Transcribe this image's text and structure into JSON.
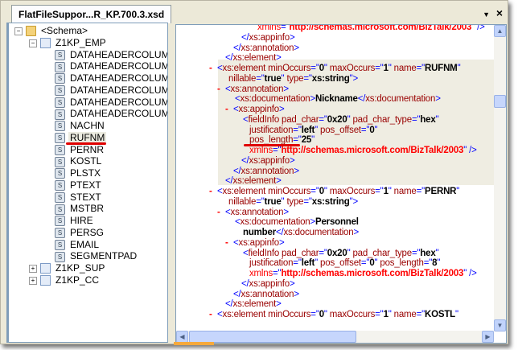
{
  "tab": {
    "title": "FlatFileSuppor...R_KP.700.3.xsd",
    "menu_icon": "dropdown-arrow-icon",
    "close_icon": "close-icon"
  },
  "tree": {
    "items": [
      {
        "label": "<Schema>",
        "level": 0,
        "icon": "folder-icon",
        "expander": "minus"
      },
      {
        "label": "Z1KP_EMP",
        "level": 1,
        "icon": "record-icon",
        "expander": "minus"
      },
      {
        "label": "DATAHEADERCOLUMN_S",
        "level": 2,
        "icon": "field-icon"
      },
      {
        "label": "DATAHEADERCOLUMN_N",
        "level": 2,
        "icon": "field-icon"
      },
      {
        "label": "DATAHEADERCOLUMN_D",
        "level": 2,
        "icon": "field-icon"
      },
      {
        "label": "DATAHEADERCOLUMN_S",
        "level": 2,
        "icon": "field-icon"
      },
      {
        "label": "DATAHEADERCOLUMN_F",
        "level": 2,
        "icon": "field-icon"
      },
      {
        "label": "DATAHEADERCOLUMN_H",
        "level": 2,
        "icon": "field-icon"
      },
      {
        "label": "NACHN",
        "level": 2,
        "icon": "field-icon"
      },
      {
        "label": "RUFNM",
        "level": 2,
        "icon": "field-icon",
        "selected": true
      },
      {
        "label": "PERNR",
        "level": 2,
        "icon": "field-icon"
      },
      {
        "label": "KOSTL",
        "level": 2,
        "icon": "field-icon"
      },
      {
        "label": "PLSTX",
        "level": 2,
        "icon": "field-icon"
      },
      {
        "label": "PTEXT",
        "level": 2,
        "icon": "field-icon"
      },
      {
        "label": "STEXT",
        "level": 2,
        "icon": "field-icon"
      },
      {
        "label": "MSTBR",
        "level": 2,
        "icon": "field-icon"
      },
      {
        "label": "HIRE",
        "level": 2,
        "icon": "field-icon"
      },
      {
        "label": "PERSG",
        "level": 2,
        "icon": "field-icon"
      },
      {
        "label": "EMAIL",
        "level": 2,
        "icon": "field-icon"
      },
      {
        "label": "SEGMENTPAD",
        "level": 2,
        "icon": "field-icon"
      },
      {
        "label": "Z1KP_SUP",
        "level": 1,
        "icon": "record-icon",
        "expander": "plus"
      },
      {
        "label": "Z1KP_CC",
        "level": 1,
        "icon": "record-icon",
        "expander": "plus"
      }
    ]
  },
  "annotation_color": "#e00000",
  "highlight_color": "#efede2",
  "xml": {
    "lines": [
      {
        "depth": 5,
        "segs": [
          [
            "x",
            "xmlns"
          ],
          [
            "t",
            "=\""
          ],
          [
            "u",
            "http://schemas.microsoft.com/BizTalk/2003"
          ],
          [
            "t",
            "\" />"
          ]
        ]
      },
      {
        "depth": 3,
        "segs": [
          [
            "t",
            "</"
          ],
          [
            "n",
            "xs:appinfo"
          ],
          [
            "t",
            ">"
          ]
        ]
      },
      {
        "depth": 2,
        "segs": [
          [
            "t",
            "</"
          ],
          [
            "n",
            "xs:annotation"
          ],
          [
            "t",
            ">"
          ]
        ]
      },
      {
        "depth": 1,
        "segs": [
          [
            "t",
            "</"
          ],
          [
            "n",
            "xs:element"
          ],
          [
            "t",
            ">"
          ]
        ]
      },
      {
        "depth": 0,
        "minus": true,
        "segs": [
          [
            "t",
            "<"
          ],
          [
            "n",
            "xs:element minOccurs"
          ],
          [
            "t",
            "=\""
          ],
          [
            "v",
            "0"
          ],
          [
            "t",
            "\" "
          ],
          [
            "n",
            "maxOccurs"
          ],
          [
            "t",
            "=\""
          ],
          [
            "v",
            "1"
          ],
          [
            "t",
            "\" "
          ],
          [
            "n",
            "name"
          ],
          [
            "t",
            "=\""
          ],
          [
            "v",
            "RUFNM"
          ],
          [
            "t",
            "\""
          ]
        ]
      },
      {
        "depth": 1.4,
        "segs": [
          [
            "n",
            "nillable"
          ],
          [
            "t",
            "=\""
          ],
          [
            "v",
            "true"
          ],
          [
            "t",
            "\" "
          ],
          [
            "n",
            "type"
          ],
          [
            "t",
            "=\""
          ],
          [
            "v",
            "xs:string"
          ],
          [
            "t",
            "\">"
          ]
        ]
      },
      {
        "depth": 1,
        "minus": true,
        "segs": [
          [
            "t",
            "<"
          ],
          [
            "n",
            "xs:annotation"
          ],
          [
            "t",
            ">"
          ]
        ]
      },
      {
        "depth": 2.2,
        "segs": [
          [
            "t",
            "<"
          ],
          [
            "n",
            "xs:documentation"
          ],
          [
            "t",
            ">"
          ],
          [
            "v",
            "Nickname"
          ],
          [
            "t",
            "</"
          ],
          [
            "n",
            "xs:documentation"
          ],
          [
            "t",
            ">"
          ]
        ]
      },
      {
        "depth": 2,
        "minus": true,
        "segs": [
          [
            "t",
            "<"
          ],
          [
            "n",
            "xs:appinfo"
          ],
          [
            "t",
            ">"
          ]
        ]
      },
      {
        "depth": 3.2,
        "segs": [
          [
            "t",
            "<"
          ],
          [
            "n",
            "fieldInfo pad_char"
          ],
          [
            "t",
            "=\""
          ],
          [
            "v",
            "0x20"
          ],
          [
            "t",
            "\" "
          ],
          [
            "n",
            "pad_char_type"
          ],
          [
            "t",
            "=\""
          ],
          [
            "v",
            "hex"
          ],
          [
            "t",
            "\""
          ]
        ]
      },
      {
        "depth": 4,
        "segs": [
          [
            "n",
            "justification"
          ],
          [
            "t",
            "=\""
          ],
          [
            "v",
            "left"
          ],
          [
            "t",
            "\" "
          ],
          [
            "n",
            "pos_offset"
          ],
          [
            "t",
            "=\""
          ],
          [
            "v",
            "0"
          ],
          [
            "t",
            "\""
          ]
        ]
      },
      {
        "depth": 4,
        "segs": [
          [
            "n",
            "pos_length"
          ],
          [
            "t",
            "=\""
          ],
          [
            "v",
            "25"
          ],
          [
            "t",
            "\""
          ]
        ]
      },
      {
        "depth": 4,
        "segs": [
          [
            "x",
            "xmlns"
          ],
          [
            "t",
            "=\""
          ],
          [
            "u",
            "http://schemas.microsoft.com/BizTalk/2003"
          ],
          [
            "t",
            "\" />"
          ]
        ]
      },
      {
        "depth": 3,
        "segs": [
          [
            "t",
            "</"
          ],
          [
            "n",
            "xs:appinfo"
          ],
          [
            "t",
            ">"
          ]
        ]
      },
      {
        "depth": 2,
        "segs": [
          [
            "t",
            "</"
          ],
          [
            "n",
            "xs:annotation"
          ],
          [
            "t",
            ">"
          ]
        ]
      },
      {
        "depth": 1,
        "segs": [
          [
            "t",
            "</"
          ],
          [
            "n",
            "xs:element"
          ],
          [
            "t",
            ">"
          ]
        ]
      },
      {
        "depth": 0,
        "minus": true,
        "segs": [
          [
            "t",
            "<"
          ],
          [
            "n",
            "xs:element minOccurs"
          ],
          [
            "t",
            "=\""
          ],
          [
            "v",
            "0"
          ],
          [
            "t",
            "\" "
          ],
          [
            "n",
            "maxOccurs"
          ],
          [
            "t",
            "=\""
          ],
          [
            "v",
            "1"
          ],
          [
            "t",
            "\" "
          ],
          [
            "n",
            "name"
          ],
          [
            "t",
            "=\""
          ],
          [
            "v",
            "PERNR"
          ],
          [
            "t",
            "\""
          ]
        ]
      },
      {
        "depth": 1.4,
        "segs": [
          [
            "n",
            "nillable"
          ],
          [
            "t",
            "=\""
          ],
          [
            "v",
            "true"
          ],
          [
            "t",
            "\" "
          ],
          [
            "n",
            "type"
          ],
          [
            "t",
            "=\""
          ],
          [
            "v",
            "xs:string"
          ],
          [
            "t",
            "\">"
          ]
        ]
      },
      {
        "depth": 1,
        "minus": true,
        "segs": [
          [
            "t",
            "<"
          ],
          [
            "n",
            "xs:annotation"
          ],
          [
            "t",
            ">"
          ]
        ]
      },
      {
        "depth": 2.2,
        "segs": [
          [
            "t",
            "<"
          ],
          [
            "n",
            "xs:documentation"
          ],
          [
            "t",
            ">"
          ],
          [
            "v",
            "Personnel"
          ]
        ]
      },
      {
        "depth": 3.2,
        "segs": [
          [
            "v",
            "number"
          ],
          [
            "t",
            "</"
          ],
          [
            "n",
            "xs:documentation"
          ],
          [
            "t",
            ">"
          ]
        ]
      },
      {
        "depth": 2,
        "minus": true,
        "segs": [
          [
            "t",
            "<"
          ],
          [
            "n",
            "xs:appinfo"
          ],
          [
            "t",
            ">"
          ]
        ]
      },
      {
        "depth": 3.2,
        "segs": [
          [
            "t",
            "<"
          ],
          [
            "n",
            "fieldInfo pad_char"
          ],
          [
            "t",
            "=\""
          ],
          [
            "v",
            "0x20"
          ],
          [
            "t",
            "\" "
          ],
          [
            "n",
            "pad_char_type"
          ],
          [
            "t",
            "=\""
          ],
          [
            "v",
            "hex"
          ],
          [
            "t",
            "\""
          ]
        ]
      },
      {
        "depth": 4,
        "segs": [
          [
            "n",
            "justification"
          ],
          [
            "t",
            "=\""
          ],
          [
            "v",
            "left"
          ],
          [
            "t",
            "\" "
          ],
          [
            "n",
            "pos_offset"
          ],
          [
            "t",
            "=\""
          ],
          [
            "v",
            "0"
          ],
          [
            "t",
            "\" "
          ],
          [
            "n",
            "pos_length"
          ],
          [
            "t",
            "=\""
          ],
          [
            "v",
            "8"
          ],
          [
            "t",
            "\""
          ]
        ]
      },
      {
        "depth": 4,
        "segs": [
          [
            "x",
            "xmlns"
          ],
          [
            "t",
            "=\""
          ],
          [
            "u",
            "http://schemas.microsoft.com/BizTalk/2003"
          ],
          [
            "t",
            "\" />"
          ]
        ]
      },
      {
        "depth": 3,
        "segs": [
          [
            "t",
            "</"
          ],
          [
            "n",
            "xs:appinfo"
          ],
          [
            "t",
            ">"
          ]
        ]
      },
      {
        "depth": 2,
        "segs": [
          [
            "t",
            "</"
          ],
          [
            "n",
            "xs:annotation"
          ],
          [
            "t",
            ">"
          ]
        ]
      },
      {
        "depth": 1,
        "segs": [
          [
            "t",
            "</"
          ],
          [
            "n",
            "xs:element"
          ],
          [
            "t",
            ">"
          ]
        ]
      },
      {
        "depth": 0,
        "minus": true,
        "segs": [
          [
            "t",
            "<"
          ],
          [
            "n",
            "xs:element minOccurs"
          ],
          [
            "t",
            "=\""
          ],
          [
            "v",
            "0"
          ],
          [
            "t",
            "\" "
          ],
          [
            "n",
            "maxOccurs"
          ],
          [
            "t",
            "=\""
          ],
          [
            "v",
            "1"
          ],
          [
            "t",
            "\" "
          ],
          [
            "n",
            "name"
          ],
          [
            "t",
            "=\""
          ],
          [
            "v",
            "KOSTL"
          ],
          [
            "t",
            "\""
          ]
        ]
      }
    ],
    "minus_glyph": "-"
  },
  "scrollbars": {
    "up": "▲",
    "down": "▼",
    "left": "◀",
    "right": "▶"
  }
}
